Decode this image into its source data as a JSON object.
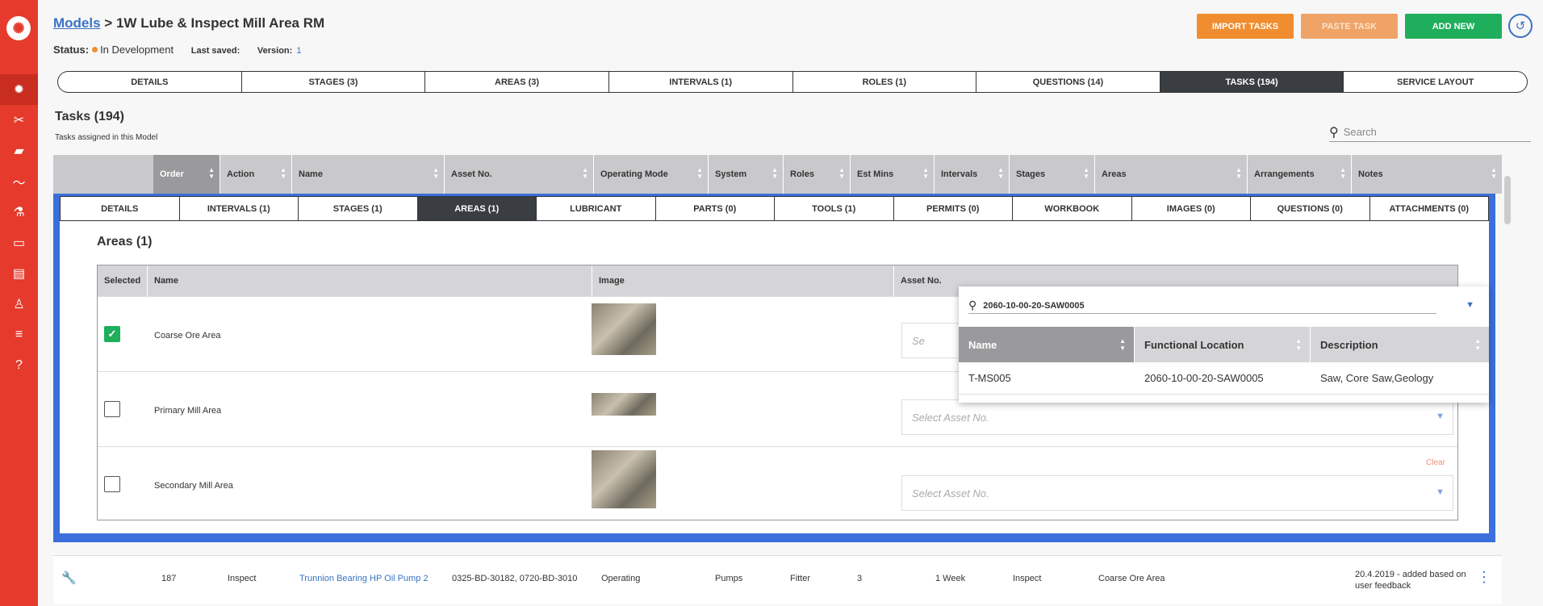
{
  "breadcrumb": {
    "link": "Models",
    "sep": ">",
    "current": "1W Lube & Inspect Mill Area RM"
  },
  "status": {
    "label": "Status:",
    "value": "In Development",
    "last_saved_label": "Last saved:",
    "version_label": "Version:",
    "version": "1"
  },
  "buttons": {
    "import": "IMPORT TASKS",
    "paste": "PASTE TASK",
    "add": "ADD NEW"
  },
  "colors": {
    "sidebar": "#e53a2c",
    "import": "#f08d2f",
    "paste": "#f0a366",
    "add": "#1fae5b",
    "accent": "#3a72c4"
  },
  "tabs": [
    "DETAILS",
    "STAGES (3)",
    "AREAS (3)",
    "INTERVALS (1)",
    "ROLES (1)",
    "QUESTIONS (14)",
    "TASKS (194)",
    "SERVICE LAYOUT"
  ],
  "section": {
    "title": "Tasks (194)",
    "subtitle": "Tasks assigned in this Model"
  },
  "search": {
    "placeholder": "Search"
  },
  "columns": [
    "Order",
    "Action",
    "Name",
    "Asset No.",
    "Operating Mode",
    "System",
    "Roles",
    "Est Mins",
    "Intervals",
    "Stages",
    "Areas",
    "Arrangements",
    "Notes"
  ],
  "subtabs": [
    "DETAILS",
    "INTERVALS (1)",
    "STAGES (1)",
    "AREAS (1)",
    "LUBRICANT",
    "PARTS (0)",
    "TOOLS (1)",
    "PERMITS (0)",
    "WORKBOOK",
    "IMAGES (0)",
    "QUESTIONS (0)",
    "ATTACHMENTS (0)"
  ],
  "areas": {
    "title": "Areas (1)",
    "headers": [
      "Selected",
      "Name",
      "Image",
      "Asset No."
    ],
    "rows": [
      {
        "name": "Coarse Ore Area",
        "selected": true
      },
      {
        "name": "Primary Mill Area",
        "selected": false,
        "placeholder": "Select Asset No."
      },
      {
        "name": "Secondary Mill Area",
        "selected": false,
        "placeholder": "Select Asset No.",
        "clear": "Clear"
      }
    ]
  },
  "dropdown": {
    "query": "2060-10-00-20-SAW0005",
    "headers": [
      "Name",
      "Functional Location",
      "Description"
    ],
    "row": {
      "name": "T-MS005",
      "location": "2060-10-00-20-SAW0005",
      "description": "Saw, Core Saw,Geology"
    }
  },
  "task_row": {
    "order": "187",
    "action": "Inspect",
    "name": "Trunnion Bearing HP Oil Pump 2",
    "asset": "0325-BD-30182, 0720-BD-3010",
    "mode": "Operating",
    "system": "Pumps",
    "roles": "Fitter",
    "est": "3",
    "interval": "1 Week",
    "stage": "Inspect",
    "area": "Coarse Ore Area",
    "notes": "20.4.2019 - added based on user feedback"
  }
}
